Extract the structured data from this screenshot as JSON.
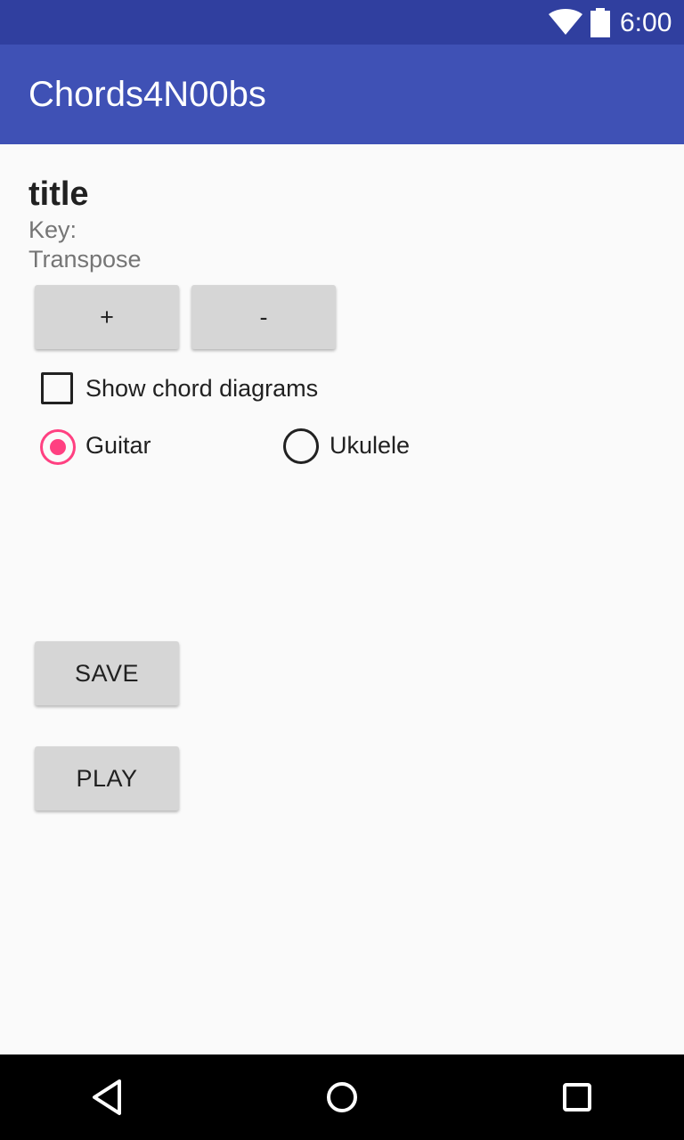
{
  "status_bar": {
    "time": "6:00",
    "icons": [
      "wifi-icon",
      "battery-icon"
    ]
  },
  "app_bar": {
    "title": "Chords4N00bs"
  },
  "song": {
    "title": "title",
    "key_label": "Key:",
    "transpose_label": "Transpose"
  },
  "transpose": {
    "plus_label": "+",
    "minus_label": "-"
  },
  "options": {
    "show_diagrams_label": "Show chord diagrams",
    "show_diagrams_checked": false,
    "instrument_options": [
      {
        "label": "Guitar",
        "selected": true
      },
      {
        "label": "Ukulele",
        "selected": false
      }
    ]
  },
  "actions": {
    "save_label": "SAVE",
    "play_label": "PLAY"
  },
  "nav_bar": {
    "icons": [
      "back-icon",
      "home-icon",
      "recents-icon"
    ]
  },
  "colors": {
    "status_bar": "#303f9f",
    "app_bar": "#3f51b5",
    "accent": "#ff4081",
    "background": "#fafafa",
    "button": "#d6d6d6"
  }
}
